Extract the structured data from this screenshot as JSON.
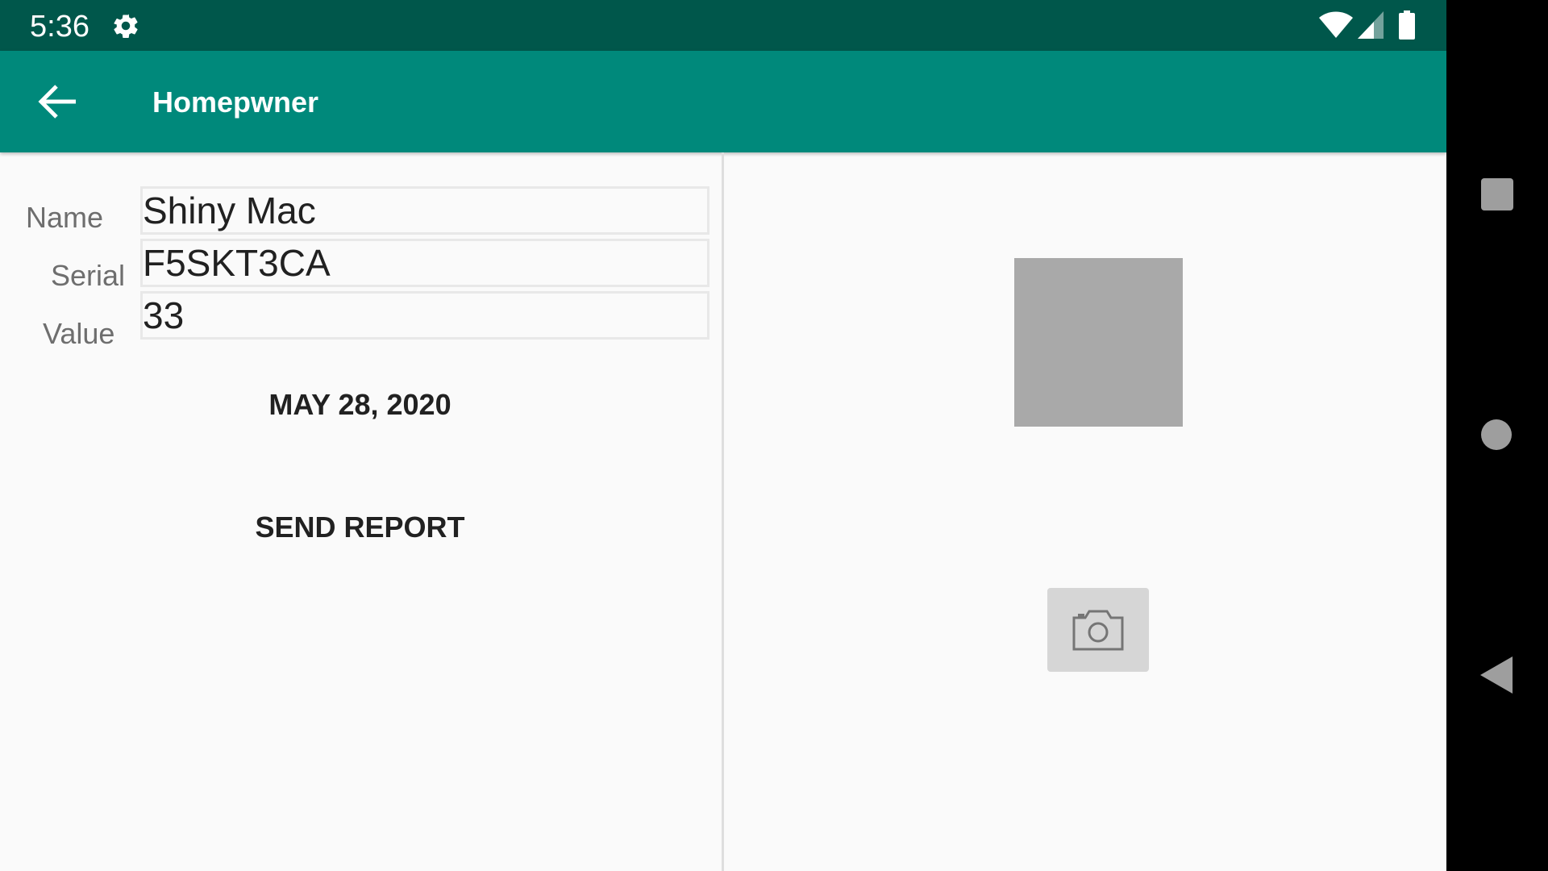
{
  "status_bar": {
    "time": "5:36",
    "icons": [
      "gear-icon",
      "wifi-icon",
      "cell-signal-icon",
      "battery-icon"
    ]
  },
  "app_bar": {
    "title": "Homepwner",
    "back_icon": "arrow-back-icon"
  },
  "form": {
    "name_label": "Name",
    "name_value": "Shiny Mac",
    "serial_label": "Serial",
    "serial_value": "F5SKT3CA",
    "value_label": "Value",
    "value_value": "33",
    "date_button": "MAY 28, 2020",
    "report_button": "SEND REPORT"
  },
  "photo": {
    "camera_icon": "camera-icon"
  },
  "nav_bar": {
    "icons": [
      "recents-square-icon",
      "home-circle-icon",
      "back-triangle-icon"
    ]
  },
  "colors": {
    "status_bar": "#00574b",
    "app_bar": "#00897b",
    "background": "#fafafa",
    "photo_placeholder": "#a9a9a9",
    "camera_button": "#d6d6d6"
  }
}
